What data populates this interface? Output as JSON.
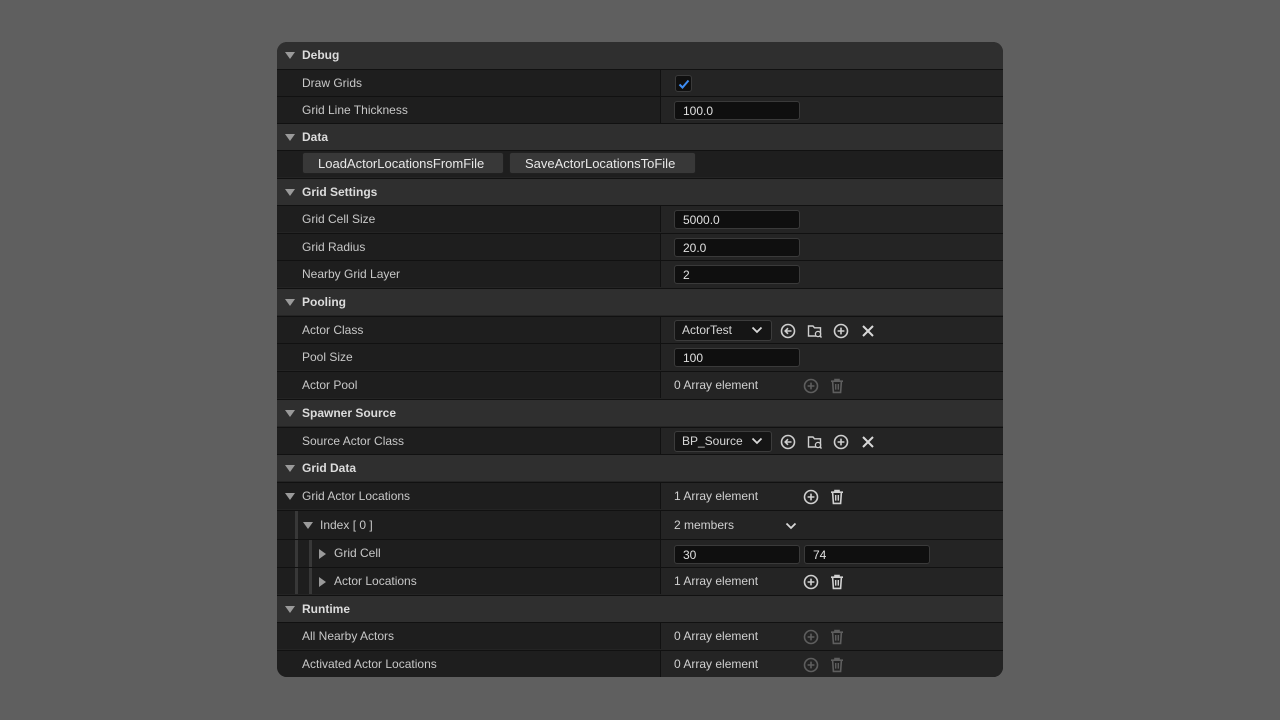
{
  "categories": {
    "debug": "Debug",
    "data": "Data",
    "grid_settings": "Grid Settings",
    "pooling": "Pooling",
    "spawner_source": "Spawner Source",
    "grid_data": "Grid Data",
    "runtime": "Runtime"
  },
  "debug": {
    "draw_grids_label": "Draw Grids",
    "draw_grids_checked": true,
    "grid_line_thickness_label": "Grid Line Thickness",
    "grid_line_thickness_value": "100.0"
  },
  "data": {
    "load_button": "LoadActorLocationsFromFile",
    "save_button": "SaveActorLocationsToFile"
  },
  "grid_settings": {
    "cell_size_label": "Grid Cell Size",
    "cell_size_value": "5000.0",
    "radius_label": "Grid Radius",
    "radius_value": "20.0",
    "nearby_layer_label": "Nearby Grid Layer",
    "nearby_layer_value": "2"
  },
  "pooling": {
    "actor_class_label": "Actor Class",
    "actor_class_value": "ActorTest",
    "pool_size_label": "Pool Size",
    "pool_size_value": "100",
    "actor_pool_label": "Actor Pool",
    "actor_pool_value": "0 Array element"
  },
  "spawner_source": {
    "source_class_label": "Source Actor Class",
    "source_class_value": "BP_Source"
  },
  "grid_data": {
    "locations_label": "Grid Actor Locations",
    "locations_value": "1 Array element",
    "index_label": "Index [ 0 ]",
    "index_value": "2 members",
    "grid_cell_label": "Grid Cell",
    "grid_cell_x": "30",
    "grid_cell_y": "74",
    "actor_locations_label": "Actor Locations",
    "actor_locations_value": "1 Array element"
  },
  "runtime": {
    "all_nearby_label": "All Nearby Actors",
    "all_nearby_value": "0 Array element",
    "activated_label": "Activated Actor Locations",
    "activated_value": "0 Array element"
  },
  "colors": {
    "background": "#5f5f5f",
    "panel": "#242424",
    "checkbox_accent": "#3d8df5"
  },
  "icons": [
    "caret-down-icon",
    "caret-right-icon",
    "checkmark-icon",
    "chevron-down-icon",
    "browse-back-icon",
    "browse-folder-icon",
    "add-circle-icon",
    "clear-x-icon",
    "trash-icon"
  ]
}
